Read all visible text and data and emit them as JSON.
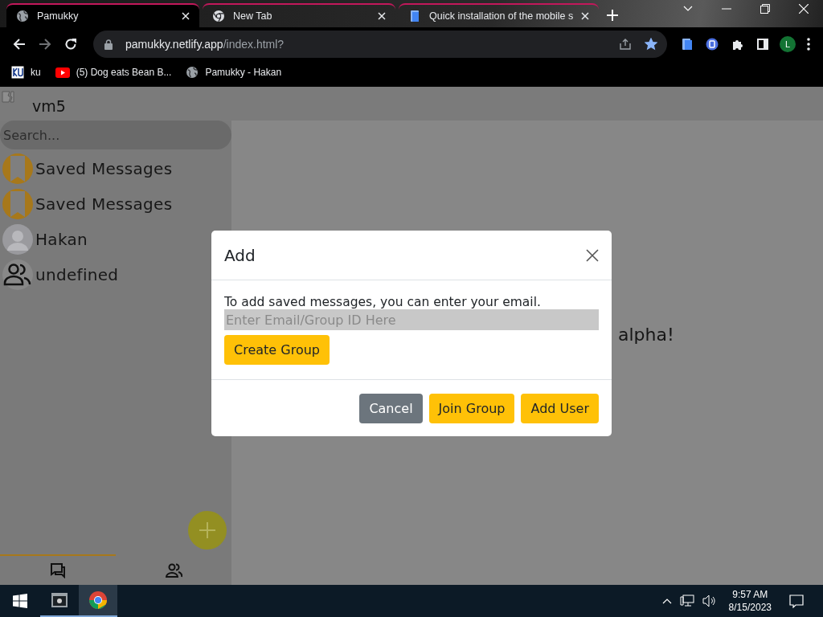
{
  "browser": {
    "tabs": [
      {
        "title": "Pamukky",
        "selected": true,
        "kind": "globe"
      },
      {
        "title": "New Tab",
        "selected": false,
        "kind": "chrome"
      },
      {
        "title": "Quick installation of the mobile s",
        "selected": false,
        "kind": "doc"
      }
    ],
    "url": {
      "host": "pamukky.netlify.app",
      "path": "/index.html?"
    },
    "bookmarked": true,
    "profile": "L",
    "bookmarks": [
      {
        "label": "ku",
        "kind": "ku"
      },
      {
        "label": "(5) Dog eats Bean B...",
        "kind": "video"
      },
      {
        "label": "Pamukky - Hakan",
        "kind": "globe"
      }
    ]
  },
  "app": {
    "user": "vm5",
    "search": {
      "placeholder": "Search..."
    },
    "chats": [
      {
        "name": "Saved Messages",
        "kind": "saved"
      },
      {
        "name": "Saved Messages",
        "kind": "saved"
      },
      {
        "name": "Hakan",
        "kind": "photo"
      },
      {
        "name": "undefined",
        "kind": "group"
      }
    ],
    "nav": [
      {
        "kind": "chats",
        "selected": true
      },
      {
        "kind": "contacts",
        "selected": false
      }
    ],
    "main_text": "alpha!"
  },
  "dialog": {
    "title": "Add",
    "description": "To add saved messages, you can enter your email.",
    "input": {
      "placeholder": "Enter Email/Group ID Here"
    },
    "create_button": "Create Group",
    "buttons": [
      {
        "label": "Cancel",
        "kind": "secondary"
      },
      {
        "label": "Join Group",
        "kind": "primary"
      },
      {
        "label": "Add User",
        "kind": "primary"
      }
    ]
  },
  "taskbar": {
    "apps": [
      {
        "kind": "terminal",
        "selected": false
      },
      {
        "kind": "chrome",
        "selected": true
      }
    ],
    "time": "9:57 AM",
    "date": "8/15/2023"
  }
}
